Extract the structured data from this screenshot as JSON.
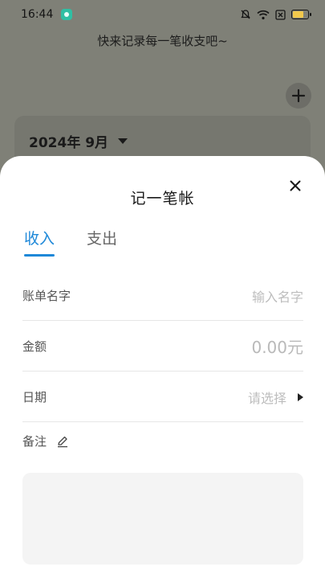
{
  "status_bar": {
    "time": "16:44",
    "icons": [
      "app-notification-icon",
      "mute-icon",
      "wifi-icon",
      "sim-x-icon",
      "battery-icon"
    ]
  },
  "header": {
    "slogan": "快来记录每一笔收支吧~",
    "add_icon": "plus-icon"
  },
  "month_card": {
    "selected_month": "2024年 9月"
  },
  "sheet": {
    "title": "记一笔帐",
    "tabs": [
      {
        "label": "收入",
        "active": true
      },
      {
        "label": "支出",
        "active": false
      }
    ],
    "fields": {
      "name_label": "账单名字",
      "name_placeholder": "输入名字",
      "amount_label": "金额",
      "amount_placeholder": "0.00元",
      "date_label": "日期",
      "date_placeholder": "请选择",
      "note_label": "备注"
    }
  },
  "colors": {
    "accent": "#1e88d8",
    "overlay_bg": "#7f8077",
    "sheet_bg": "#ffffff"
  }
}
